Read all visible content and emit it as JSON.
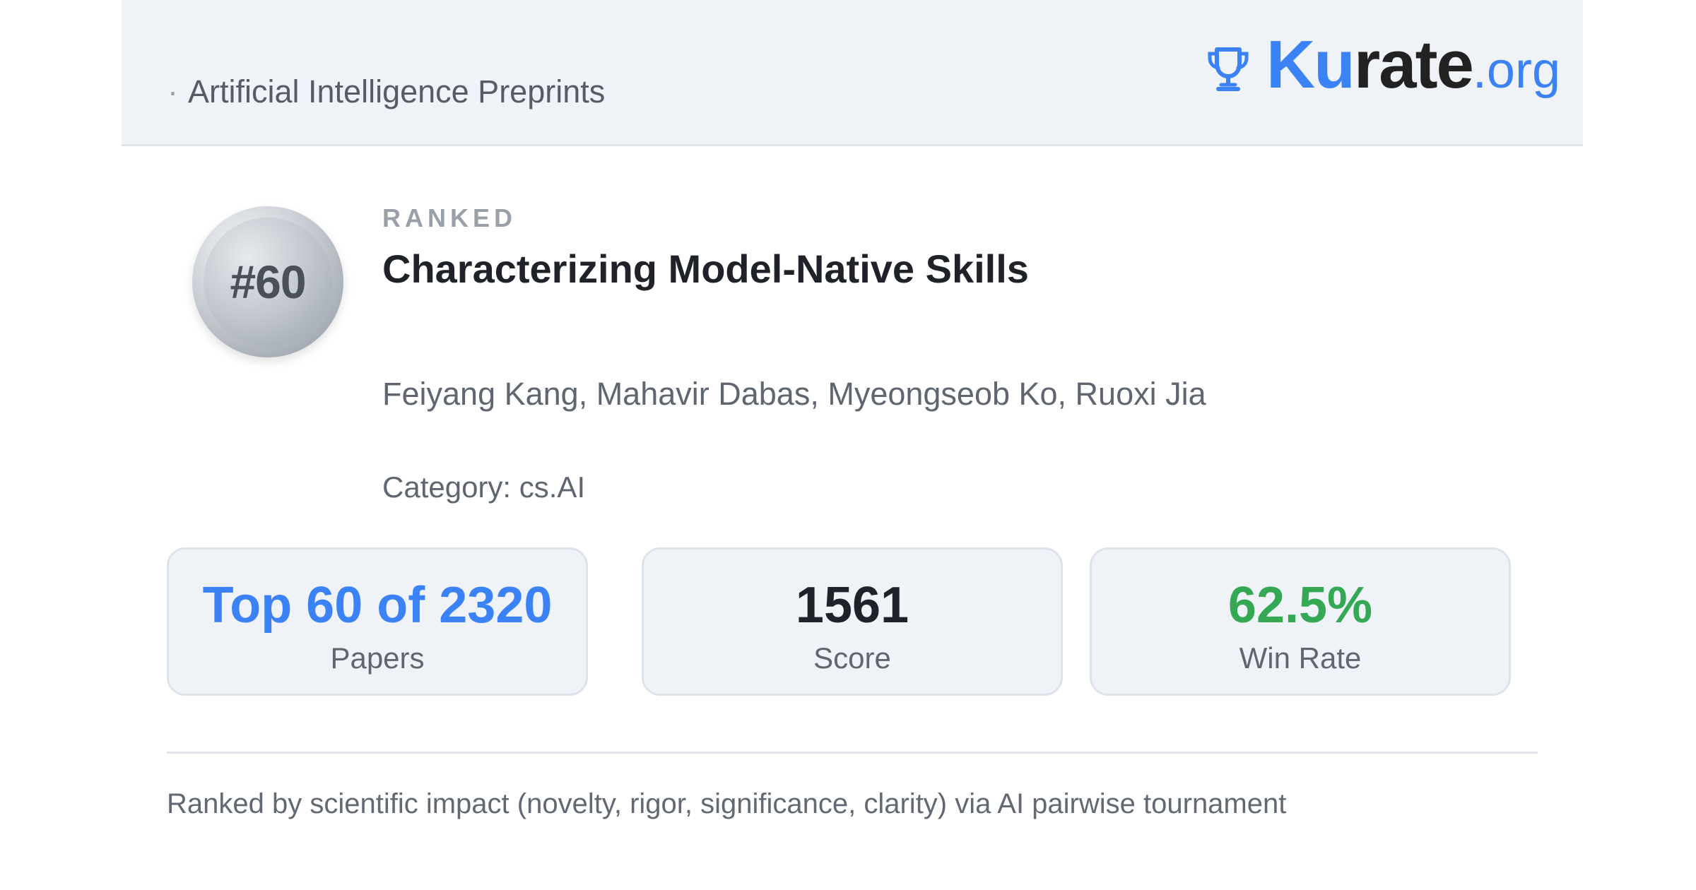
{
  "header": {
    "dot": "·",
    "source": "Artificial Intelligence Preprints",
    "logo": {
      "icon": "trophy-icon",
      "ku": "Ku",
      "rate": "rate",
      "org": ".org"
    }
  },
  "medal": {
    "rank": "#60"
  },
  "paper": {
    "ranked_label": "RANKED",
    "title": "Characterizing Model-Native Skills",
    "authors": "Feiyang Kang, Mahavir Dabas, Myeongseob Ko, Ruoxi Jia",
    "category": "Category: cs.AI"
  },
  "stats": [
    {
      "value": "Top 60 of 2320",
      "label": "Papers",
      "color": "#3b82f6"
    },
    {
      "value": "1561",
      "label": "Score",
      "color": "#1f2329"
    },
    {
      "value": "62.5%",
      "label": "Win Rate",
      "color": "#34a853"
    }
  ],
  "footer": {
    "note": "Ranked by scientific impact (novelty, rigor, significance, clarity) via AI pairwise tournament"
  },
  "colors": {
    "accent": "#3b82f6",
    "header_bg": "#eff3f8",
    "win": "#34a853"
  }
}
